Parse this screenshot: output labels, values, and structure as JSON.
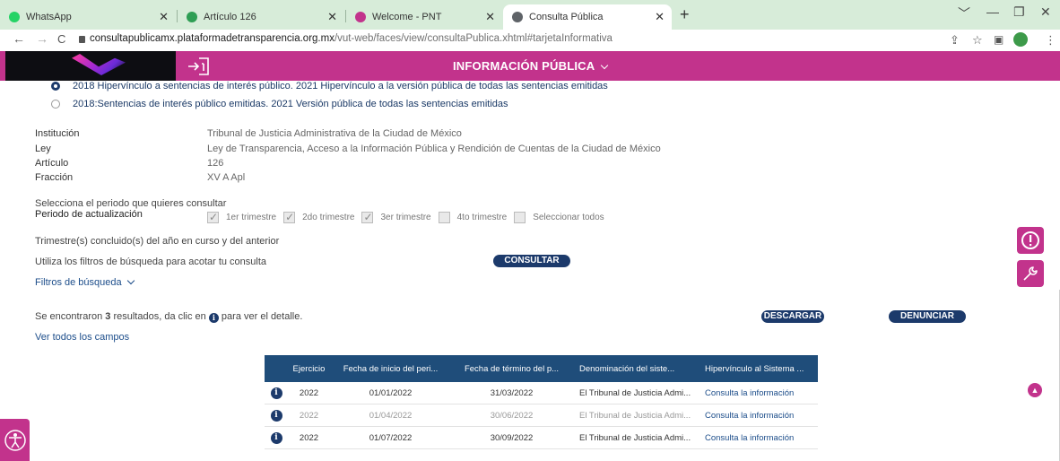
{
  "browser": {
    "tabs": [
      {
        "title": "WhatsApp",
        "favicon_color": "#25d366",
        "active": false
      },
      {
        "title": "Artículo 126",
        "favicon_color": "#2e9e54",
        "active": false
      },
      {
        "title": "Welcome - PNT",
        "favicon_color": "#c2338c",
        "active": false
      },
      {
        "title": "Consulta Pública",
        "favicon_color": "#5f6368",
        "active": true
      }
    ],
    "new_tab_icon": "plus-icon",
    "url_host": "consultapublicamx.plataformadetransparencia.org.mx",
    "url_path": "/vut-web/faces/view/consultaPublica.xhtml#tarjetaInformativa"
  },
  "header": {
    "title": "INFORMACIÓN PÚBLICA",
    "brand_color": "#c2338c",
    "login_icon": "login-icon"
  },
  "formats": [
    {
      "label": "2018 Hipervínculo a sentencias de interés público. 2021 Hipervínculo a la versión pública de todas las sentencias emitidas",
      "selected": true
    },
    {
      "label": "2018:Sentencias de interés público emitidas. 2021 Versión pública de todas las sentencias emitidas",
      "selected": false
    }
  ],
  "details": [
    {
      "label": "Institución",
      "value": "Tribunal de Justicia Administrativa de la Ciudad de México"
    },
    {
      "label": "Ley",
      "value": "Ley de Transparencia, Acceso a la Información Pública y Rendición de Cuentas de la Ciudad de México"
    },
    {
      "label": "Artículo",
      "value": "126"
    },
    {
      "label": "Fracción",
      "value": "XV A Apl"
    }
  ],
  "period": {
    "prompt": "Selecciona el periodo que quieres consultar",
    "label": "Periodo de actualización",
    "options": [
      {
        "label": "1er trimestre",
        "checked": true
      },
      {
        "label": "2do trimestre",
        "checked": true
      },
      {
        "label": "3er trimestre",
        "checked": true
      },
      {
        "label": "4to trimestre",
        "checked": false
      },
      {
        "label": "Seleccionar todos",
        "checked": false
      }
    ],
    "note": "Trimestre(s) concluido(s) del año en curso y del anterior"
  },
  "filters": {
    "hint": "Utiliza los filtros de búsqueda para acotar tu consulta",
    "consult_button": "CONSULTAR",
    "toggle_label": "Filtros de búsqueda"
  },
  "results": {
    "prefix": "Se encontraron ",
    "count": "3",
    "middle": " resultados, da clic en ",
    "suffix": " para ver el detalle.",
    "download_button": "DESCARGAR",
    "report_button": "DENUNCIAR",
    "all_fields_link": "Ver todos los campos"
  },
  "table": {
    "columns": [
      "Ejercicio",
      "Fecha de inicio del peri...",
      "Fecha de término del p...",
      "Denominación del siste...",
      "Hipervínculo al Sistema ..."
    ],
    "rows": [
      {
        "year": "2022",
        "start": "01/01/2022",
        "end": "31/03/2022",
        "name": "El Tribunal de Justicia Admi...",
        "link": "Consulta la información",
        "faded": false
      },
      {
        "year": "2022",
        "start": "01/04/2022",
        "end": "30/06/2022",
        "name": "El Tribunal de Justicia Admi...",
        "link": "Consulta la información",
        "faded": true
      },
      {
        "year": "2022",
        "start": "01/07/2022",
        "end": "30/09/2022",
        "name": "El Tribunal de Justicia Admi...",
        "link": "Consulta la información",
        "faded": false
      }
    ]
  },
  "side_buttons": [
    "alert-icon",
    "wrench-icon",
    "arrow-up-icon"
  ],
  "accessibility_icon": "accessibility-icon"
}
